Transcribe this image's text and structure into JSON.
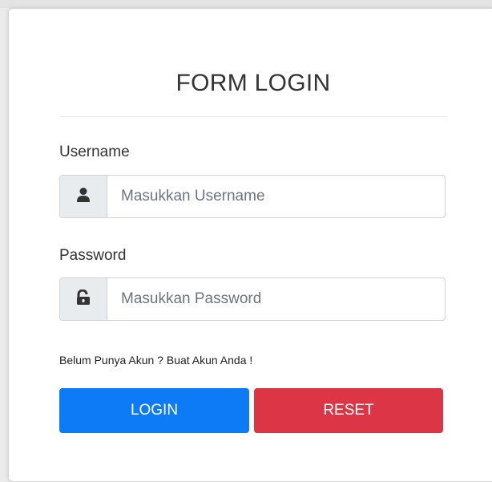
{
  "form": {
    "title": "FORM LOGIN",
    "username": {
      "label": "Username",
      "placeholder": "Masukkan Username",
      "icon": "user-icon"
    },
    "password": {
      "label": "Password",
      "placeholder": "Masukkan Password",
      "icon": "lock-icon"
    },
    "register_hint": "Belum Punya Akun ? Buat Akun Anda !",
    "buttons": {
      "login": "LOGIN",
      "reset": "RESET"
    }
  },
  "colors": {
    "login_button": "#0d7bf6",
    "reset_button": "#dc3546",
    "addon_background": "#e9ecef"
  }
}
